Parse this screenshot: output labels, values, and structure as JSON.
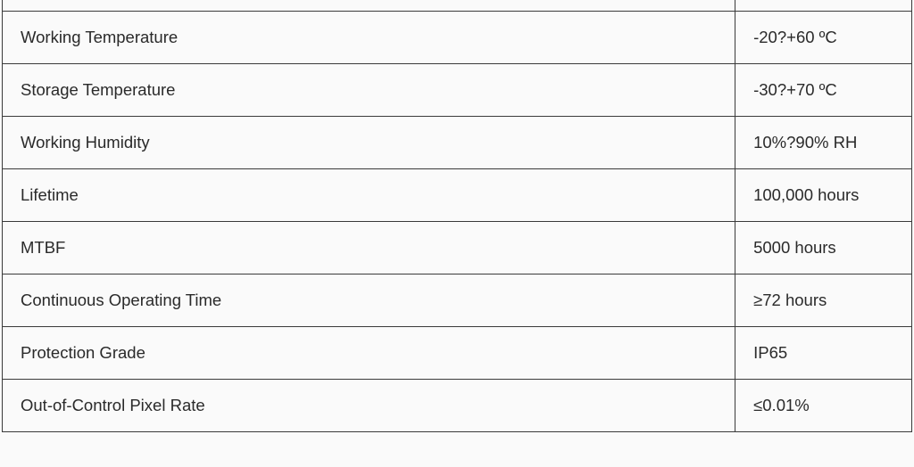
{
  "specs": {
    "rows": [
      {
        "label": "Working Temperature",
        "value": "-20?+60 ºC"
      },
      {
        "label": "Storage Temperature",
        "value": "-30?+70 ºC"
      },
      {
        "label": "Working Humidity",
        "value": "10%?90% RH"
      },
      {
        "label": "Lifetime",
        "value": "100,000 hours"
      },
      {
        "label": "MTBF",
        "value": "5000 hours"
      },
      {
        "label": "Continuous Operating Time",
        "value": "≥72 hours"
      },
      {
        "label": "Protection Grade",
        "value": "IP65"
      },
      {
        "label": "Out-of-Control Pixel Rate",
        "value": "≤0.01%"
      }
    ]
  }
}
